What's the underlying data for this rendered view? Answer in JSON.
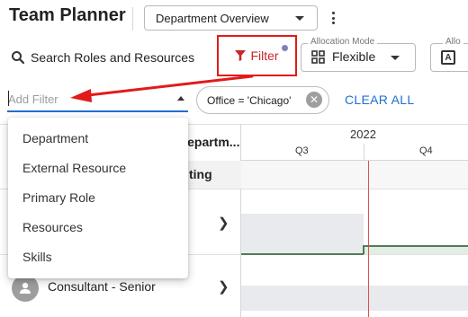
{
  "header": {
    "app_title": "Team Planner",
    "view_select": {
      "value": "Department Overview"
    }
  },
  "toolbar": {
    "search_label": "Search Roles and Resources",
    "filter_label": "Filter",
    "allocation_mode": {
      "label": "Allocation Mode",
      "value": "Flexible"
    },
    "second_control": {
      "label": "Allo",
      "icon_letter": "A"
    }
  },
  "filter_bar": {
    "add_filter_placeholder": "Add Filter",
    "active_chip": "Office = 'Chicago'",
    "clear_all_label": "CLEAR ALL"
  },
  "filter_menu": {
    "items": [
      {
        "label": "Department"
      },
      {
        "label": "External Resource"
      },
      {
        "label": "Primary Role"
      },
      {
        "label": "Resources"
      },
      {
        "label": "Skills"
      }
    ]
  },
  "grid": {
    "column_header": "Departm...",
    "group_label_fragment": "ting",
    "rows": [
      {
        "name": ""
      },
      {
        "name": "Consultant - Senior"
      }
    ]
  },
  "timeline": {
    "year": "2022",
    "quarters": [
      "Q3",
      "Q4"
    ]
  },
  "colors": {
    "accent_blue": "#1e6fd0",
    "annotation_red": "#e21a1a",
    "today_line": "#d9534f",
    "allocation_green": "#4e7d57"
  }
}
